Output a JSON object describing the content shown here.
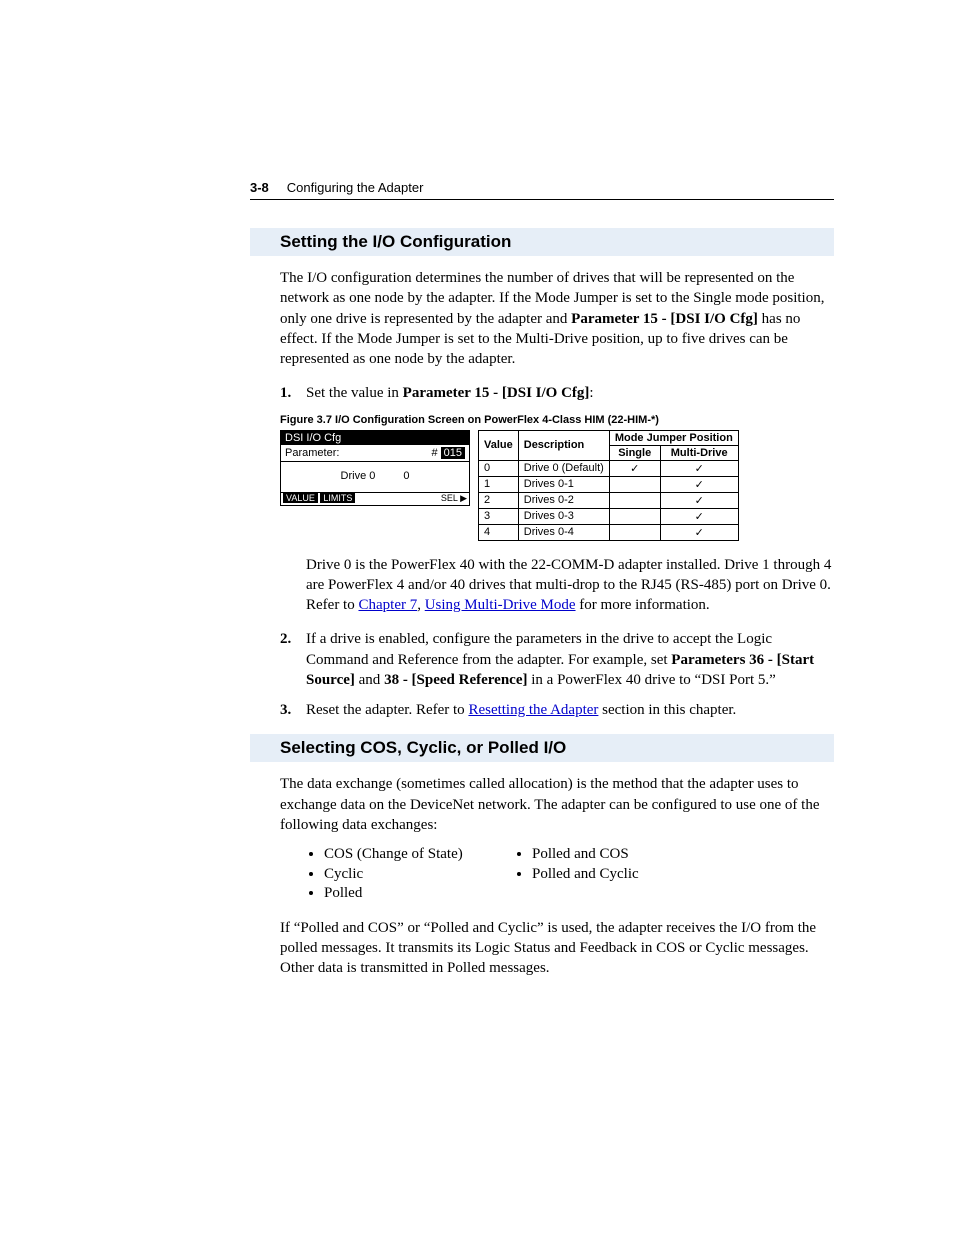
{
  "header": {
    "page_number": "3-8",
    "chapter_title": "Configuring the Adapter"
  },
  "section1": {
    "title": "Setting the I/O Configuration",
    "intro_a": "The I/O configuration determines the number of drives that will be represented on the network as one node by the adapter. If the Mode Jumper is set to the Single mode position, only one drive is represented by the adapter and ",
    "intro_param": "Parameter 15 - [DSI I/O Cfg]",
    "intro_b": " has no effect. If the Mode Jumper is set to the Multi-Drive position, up to five drives can be represented as one node by the adapter.",
    "step1_a": "Set the value in ",
    "step1_b": "Parameter 15 - [DSI I/O Cfg]",
    "step1_c": ":",
    "fig_caption": "Figure 3.7   I/O Configuration Screen on PowerFlex 4-Class HIM (22-HIM-*)",
    "him": {
      "title": "DSI I/O Cfg",
      "param_label": "Parameter:",
      "param_hash": "#",
      "param_num": "015",
      "drive_label": "Drive 0",
      "drive_val": "0",
      "footer_value": "VALUE",
      "footer_limits": "LIMITS",
      "footer_sel": "SEL"
    },
    "table": {
      "h_value": "Value",
      "h_desc": "Description",
      "h_mode": "Mode Jumper Position",
      "h_single": "Single",
      "h_multi": "Multi-Drive",
      "rows": [
        {
          "v": "0",
          "d": "Drive 0 (Default)",
          "s": "✓",
          "m": "✓"
        },
        {
          "v": "1",
          "d": "Drives 0-1",
          "s": "",
          "m": "✓"
        },
        {
          "v": "2",
          "d": "Drives 0-2",
          "s": "",
          "m": "✓"
        },
        {
          "v": "3",
          "d": "Drives 0-3",
          "s": "",
          "m": "✓"
        },
        {
          "v": "4",
          "d": "Drives 0-4",
          "s": "",
          "m": "✓"
        }
      ]
    },
    "drive0_a": "Drive 0 is the PowerFlex 40 with the 22-COMM-D adapter installed. Drive 1 through 4 are PowerFlex 4 and/or 40 drives that multi-drop to the RJ45 (RS-485) port on Drive 0. Refer to ",
    "link_ch7": "Chapter 7",
    "drive0_b": ", ",
    "link_mdm": "Using Multi-Drive Mode",
    "drive0_c": " for more information.",
    "step2_a": "If a drive is enabled, configure the parameters in the drive to accept the Logic Command and Reference from the adapter. For example, set ",
    "step2_p1": "Parameters 36 - [Start Source]",
    "step2_mid": " and ",
    "step2_p2": "38 - [Speed Reference]",
    "step2_b": " in a PowerFlex 40 drive to “DSI Port 5.”",
    "step3_a": "Reset the adapter. Refer to ",
    "link_reset": "Resetting the Adapter",
    "step3_b": " section in this chapter."
  },
  "section2": {
    "title": "Selecting COS, Cyclic, or Polled I/O",
    "intro": "The data exchange (sometimes called allocation) is the method that the adapter uses to exchange data on the DeviceNet network. The adapter can be configured to use one of the following data exchanges:",
    "col1": [
      "COS (Change of State)",
      "Cyclic",
      "Polled"
    ],
    "col2": [
      "Polled and COS",
      "Polled and Cyclic"
    ],
    "outro": "If “Polled and COS” or “Polled and Cyclic” is used, the adapter receives the I/O from the polled messages. It transmits its Logic Status and Feedback in COS or Cyclic messages. Other data is transmitted in Polled messages."
  }
}
